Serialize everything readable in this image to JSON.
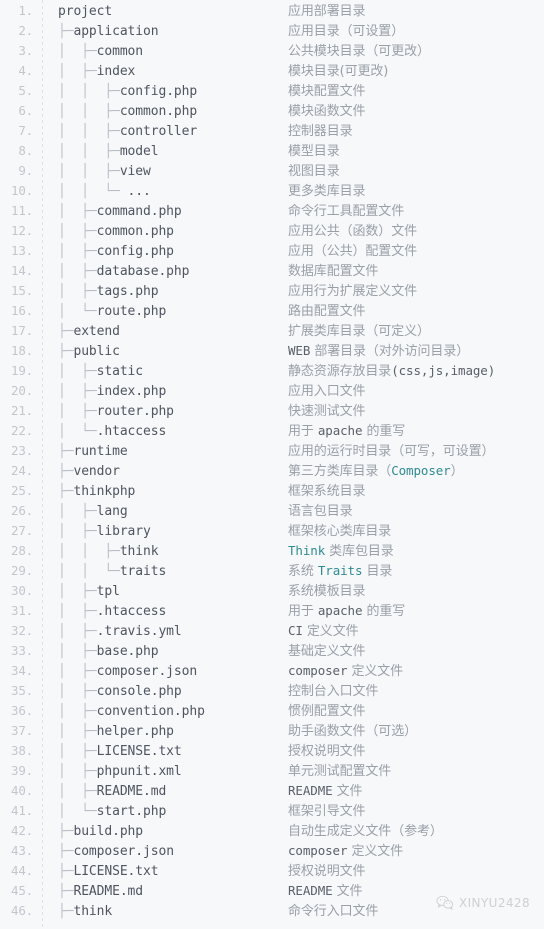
{
  "document": {
    "type": "code-listing",
    "language": "plaintext",
    "title": "ThinkPHP 5 Directory Structure",
    "total_lines": 46,
    "colors": {
      "background": "#f7f8fa",
      "line_number": "#c2c7ce",
      "tree_text": "#4f5560",
      "tree_glyph": "#b9bec6",
      "description": "#9aa0a8",
      "inline_mono": "#5a6069",
      "highlight_teal": "#2e8b92"
    }
  },
  "watermark": {
    "icon": "wechat-icon",
    "text": "XINYU2428"
  },
  "lines": [
    {
      "n": "1.",
      "tree": "project",
      "glyph": "",
      "desc_parts": [
        {
          "t": "plain",
          "s": "应用部署目录"
        }
      ]
    },
    {
      "n": "2.",
      "tree": "├─application",
      "desc_parts": [
        {
          "t": "plain",
          "s": "应用目录（可设置）"
        }
      ]
    },
    {
      "n": "3.",
      "tree": "│  ├─common",
      "desc_parts": [
        {
          "t": "plain",
          "s": "公共模块目录（可更改）"
        }
      ]
    },
    {
      "n": "4.",
      "tree": "│  ├─index",
      "desc_parts": [
        {
          "t": "plain",
          "s": "模块目录(可更改)"
        }
      ]
    },
    {
      "n": "5.",
      "tree": "│  │  ├─config.php",
      "desc_parts": [
        {
          "t": "plain",
          "s": "模块配置文件"
        }
      ]
    },
    {
      "n": "6.",
      "tree": "│  │  ├─common.php",
      "desc_parts": [
        {
          "t": "plain",
          "s": "模块函数文件"
        }
      ]
    },
    {
      "n": "7.",
      "tree": "│  │  ├─controller",
      "desc_parts": [
        {
          "t": "plain",
          "s": "控制器目录"
        }
      ]
    },
    {
      "n": "8.",
      "tree": "│  │  ├─model",
      "desc_parts": [
        {
          "t": "plain",
          "s": "模型目录"
        }
      ]
    },
    {
      "n": "9.",
      "tree": "│  │  ├─view",
      "desc_parts": [
        {
          "t": "plain",
          "s": "视图目录"
        }
      ]
    },
    {
      "n": "10.",
      "tree": "│  │  └─ ...",
      "desc_parts": [
        {
          "t": "plain",
          "s": "更多类库目录"
        }
      ]
    },
    {
      "n": "11.",
      "tree": "│  ├─command.php",
      "desc_parts": [
        {
          "t": "plain",
          "s": "命令行工具配置文件"
        }
      ]
    },
    {
      "n": "12.",
      "tree": "│  ├─common.php",
      "desc_parts": [
        {
          "t": "plain",
          "s": "应用公共（函数）文件"
        }
      ]
    },
    {
      "n": "13.",
      "tree": "│  ├─config.php",
      "desc_parts": [
        {
          "t": "plain",
          "s": "应用（公共）配置文件"
        }
      ]
    },
    {
      "n": "14.",
      "tree": "│  ├─database.php",
      "desc_parts": [
        {
          "t": "plain",
          "s": "数据库配置文件"
        }
      ]
    },
    {
      "n": "15.",
      "tree": "│  ├─tags.php",
      "desc_parts": [
        {
          "t": "plain",
          "s": "应用行为扩展定义文件"
        }
      ]
    },
    {
      "n": "16.",
      "tree": "│  └─route.php",
      "desc_parts": [
        {
          "t": "plain",
          "s": "路由配置文件"
        }
      ]
    },
    {
      "n": "17.",
      "tree": "├─extend",
      "desc_parts": [
        {
          "t": "plain",
          "s": "扩展类库目录（可定义）"
        }
      ]
    },
    {
      "n": "18.",
      "tree": "├─public",
      "desc_parts": [
        {
          "t": "mono",
          "s": "WEB"
        },
        {
          "t": "plain",
          "s": " 部署目录（对外访问目录）"
        }
      ]
    },
    {
      "n": "19.",
      "tree": "│  ├─static",
      "desc_parts": [
        {
          "t": "plain",
          "s": "静态资源存放目录"
        },
        {
          "t": "mono",
          "s": "(css,js,image)"
        }
      ]
    },
    {
      "n": "20.",
      "tree": "│  ├─index.php",
      "desc_parts": [
        {
          "t": "plain",
          "s": "应用入口文件"
        }
      ]
    },
    {
      "n": "21.",
      "tree": "│  ├─router.php",
      "desc_parts": [
        {
          "t": "plain",
          "s": "快速测试文件"
        }
      ]
    },
    {
      "n": "22.",
      "tree": "│  └─.htaccess",
      "desc_parts": [
        {
          "t": "plain",
          "s": "用于 "
        },
        {
          "t": "mono",
          "s": "apache"
        },
        {
          "t": "plain",
          "s": " 的重写"
        }
      ]
    },
    {
      "n": "23.",
      "tree": "├─runtime",
      "desc_parts": [
        {
          "t": "plain",
          "s": "应用的运行时目录（可写，可设置）"
        }
      ]
    },
    {
      "n": "24.",
      "tree": "├─vendor",
      "desc_parts": [
        {
          "t": "plain",
          "s": "第三方类库目录（"
        },
        {
          "t": "hl",
          "s": "Composer"
        },
        {
          "t": "plain",
          "s": "）"
        }
      ]
    },
    {
      "n": "25.",
      "tree": "├─thinkphp",
      "desc_parts": [
        {
          "t": "plain",
          "s": "框架系统目录"
        }
      ]
    },
    {
      "n": "26.",
      "tree": "│  ├─lang",
      "desc_parts": [
        {
          "t": "plain",
          "s": "语言包目录"
        }
      ]
    },
    {
      "n": "27.",
      "tree": "│  ├─library",
      "desc_parts": [
        {
          "t": "plain",
          "s": "框架核心类库目录"
        }
      ]
    },
    {
      "n": "28.",
      "tree": "│  │  ├─think",
      "desc_parts": [
        {
          "t": "hl",
          "s": "Think"
        },
        {
          "t": "plain",
          "s": " 类库包目录"
        }
      ]
    },
    {
      "n": "29.",
      "tree": "│  │  └─traits",
      "desc_parts": [
        {
          "t": "plain",
          "s": "系统 "
        },
        {
          "t": "hl",
          "s": "Traits"
        },
        {
          "t": "plain",
          "s": " 目录"
        }
      ]
    },
    {
      "n": "30.",
      "tree": "│  ├─tpl",
      "desc_parts": [
        {
          "t": "plain",
          "s": "系统模板目录"
        }
      ]
    },
    {
      "n": "31.",
      "tree": "│  ├─.htaccess",
      "desc_parts": [
        {
          "t": "plain",
          "s": "用于 "
        },
        {
          "t": "mono",
          "s": "apache"
        },
        {
          "t": "plain",
          "s": " 的重写"
        }
      ]
    },
    {
      "n": "32.",
      "tree": "│  ├─.travis.yml",
      "desc_parts": [
        {
          "t": "mono",
          "s": "CI"
        },
        {
          "t": "plain",
          "s": " 定义文件"
        }
      ]
    },
    {
      "n": "33.",
      "tree": "│  ├─base.php",
      "desc_parts": [
        {
          "t": "plain",
          "s": "基础定义文件"
        }
      ]
    },
    {
      "n": "34.",
      "tree": "│  ├─composer.json",
      "desc_parts": [
        {
          "t": "mono",
          "s": "composer"
        },
        {
          "t": "plain",
          "s": " 定义文件"
        }
      ]
    },
    {
      "n": "35.",
      "tree": "│  ├─console.php",
      "desc_parts": [
        {
          "t": "plain",
          "s": "控制台入口文件"
        }
      ]
    },
    {
      "n": "36.",
      "tree": "│  ├─convention.php",
      "desc_parts": [
        {
          "t": "plain",
          "s": "惯例配置文件"
        }
      ]
    },
    {
      "n": "37.",
      "tree": "│  ├─helper.php",
      "desc_parts": [
        {
          "t": "plain",
          "s": "助手函数文件（可选）"
        }
      ]
    },
    {
      "n": "38.",
      "tree": "│  ├─LICENSE.txt",
      "desc_parts": [
        {
          "t": "plain",
          "s": "授权说明文件"
        }
      ]
    },
    {
      "n": "39.",
      "tree": "│  ├─phpunit.xml",
      "desc_parts": [
        {
          "t": "plain",
          "s": "单元测试配置文件"
        }
      ]
    },
    {
      "n": "40.",
      "tree": "│  ├─README.md",
      "desc_parts": [
        {
          "t": "mono",
          "s": "README"
        },
        {
          "t": "plain",
          "s": " 文件"
        }
      ]
    },
    {
      "n": "41.",
      "tree": "│  └─start.php",
      "desc_parts": [
        {
          "t": "plain",
          "s": "框架引导文件"
        }
      ]
    },
    {
      "n": "42.",
      "tree": "├─build.php",
      "desc_parts": [
        {
          "t": "plain",
          "s": "自动生成定义文件（参考）"
        }
      ]
    },
    {
      "n": "43.",
      "tree": "├─composer.json",
      "desc_parts": [
        {
          "t": "mono",
          "s": "composer"
        },
        {
          "t": "plain",
          "s": " 定义文件"
        }
      ]
    },
    {
      "n": "44.",
      "tree": "├─LICENSE.txt",
      "desc_parts": [
        {
          "t": "plain",
          "s": "授权说明文件"
        }
      ]
    },
    {
      "n": "45.",
      "tree": "├─README.md",
      "desc_parts": [
        {
          "t": "mono",
          "s": "README"
        },
        {
          "t": "plain",
          "s": " 文件"
        }
      ]
    },
    {
      "n": "46.",
      "tree": "├─think",
      "desc_parts": [
        {
          "t": "plain",
          "s": "命令行入口文件"
        }
      ]
    }
  ]
}
